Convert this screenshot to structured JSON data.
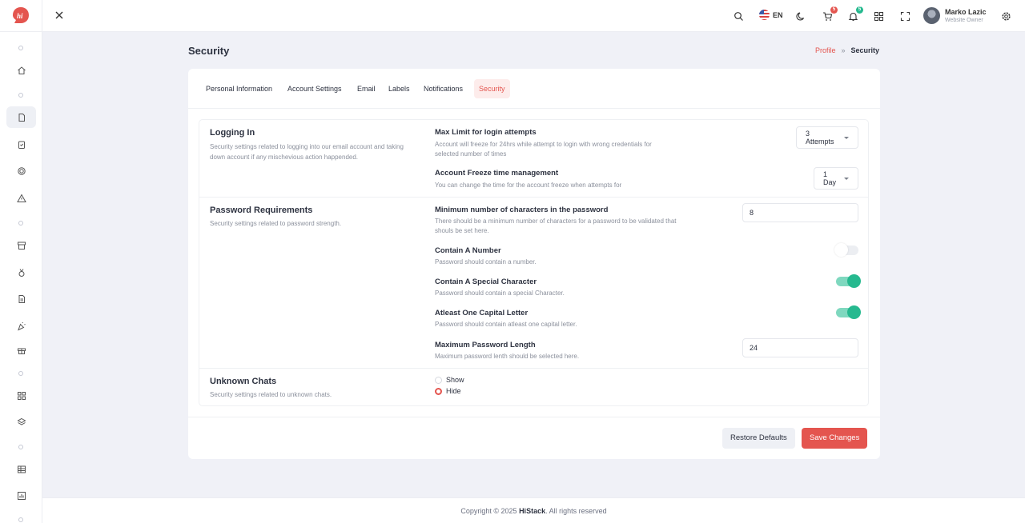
{
  "header": {
    "language": "EN",
    "cart_count": "5",
    "notif_count": "5",
    "user_name": "Marko Lazic",
    "user_role": "Website Owner"
  },
  "page": {
    "title": "Security",
    "breadcrumb": [
      "Profile",
      "Security"
    ]
  },
  "tabs": [
    "Personal Information",
    "Account Settings",
    "Email",
    "Labels",
    "Notifications",
    "Security"
  ],
  "sections": {
    "logging": {
      "title": "Logging In",
      "desc": "Security settings related to logging into our email account and taking down account if any mischevious action happended.",
      "max_attempts": {
        "title": "Max Limit for login attempts",
        "desc": "Account will freeze for 24hrs while attempt to login with wrong credentials for selected number of times",
        "value": "3 Attempts"
      },
      "freeze": {
        "title": "Account Freeze time management",
        "desc": "You can change the time for the account freeze when attempts for",
        "value": "1 Day"
      }
    },
    "password": {
      "title": "Password Requirements",
      "desc": "Security settings related to password strength.",
      "min_chars": {
        "title": "Minimum number of characters in the password",
        "desc": "There should be a minimum number of characters for a password to be validated that shouls be set here.",
        "value": "8"
      },
      "number": {
        "title": "Contain A Number",
        "desc": "Password should contain a number.",
        "enabled": false
      },
      "special": {
        "title": "Contain A Special Character",
        "desc": "Password should contain a special Character.",
        "enabled": true
      },
      "capital": {
        "title": "Atleast One Capital Letter",
        "desc": "Password should contain atleast one capital letter.",
        "enabled": true
      },
      "max_len": {
        "title": "Maximum Password Length",
        "desc": "Maximum password lenth should be selected here.",
        "value": "24"
      }
    },
    "chats": {
      "title": "Unknown Chats",
      "desc": "Security settings related to unknown chats.",
      "options": [
        "Show",
        "Hide"
      ],
      "selected": "Hide"
    }
  },
  "buttons": {
    "restore": "Restore Defaults",
    "save": "Save Changes"
  },
  "footer": {
    "prefix": "Copyright © 2025",
    "brand": "HiStack",
    "suffix": ". All rights reserved"
  },
  "colors": {
    "accent": "#e4554f",
    "toggle_on": "#26b98f"
  }
}
